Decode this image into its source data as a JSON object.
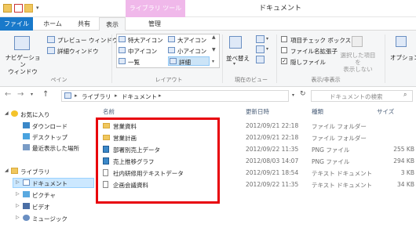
{
  "titlebar": {
    "context_tab": "ライブラリ ツール",
    "window_title": "ドキュメント"
  },
  "tabs": {
    "file": "ファイル",
    "home": "ホーム",
    "share": "共有",
    "view": "表示",
    "manage": "管理"
  },
  "ribbon": {
    "navpane_label": "ナビゲーション\nウィンドウ",
    "preview_pane": "プレビュー ウィンドウ",
    "details_pane": "詳細ウィンドウ",
    "pane_group": "ペイン",
    "layout": {
      "extra_large": "特大アイコン",
      "large": "大アイコン",
      "medium": "中アイコン",
      "small": "小アイコン",
      "list": "一覧",
      "details": "詳細",
      "group": "レイアウト"
    },
    "sort": "並べ替え",
    "current_view_group": "現在のビュー",
    "item_checkbox": "項目チェック ボックス",
    "file_ext": "ファイル名拡張子",
    "hidden_files": "隠しファイル",
    "hidden_checked": "✓",
    "show_hide_group": "表示/非表示",
    "hide_selected": "選択した項目を\n表示しない",
    "options": "オプション"
  },
  "address": {
    "path_1": "ライブラリ",
    "path_2": "ドキュメント",
    "search_placeholder": "ドキュメントの検索"
  },
  "nav": {
    "favorites": "お気に入り",
    "downloads": "ダウンロード",
    "desktop": "デスクトップ",
    "recent": "最近表示した場所",
    "libraries": "ライブラリ",
    "documents": "ドキュメント",
    "pictures": "ピクチャ",
    "videos": "ビデオ",
    "music": "ミュージック"
  },
  "columns": {
    "name": "名前",
    "modified": "更新日時",
    "type": "種類",
    "size": "サイズ"
  },
  "files": [
    {
      "name": "営業資料",
      "modified": "2012/09/21 22:18",
      "type": "ファイル フォルダー",
      "size": "",
      "icon": "folder"
    },
    {
      "name": "営業計画",
      "modified": "2012/09/21 22:18",
      "type": "ファイル フォルダー",
      "size": "",
      "icon": "folder"
    },
    {
      "name": "部署別売上データ",
      "modified": "2012/09/22 11:35",
      "type": "PNG ファイル",
      "size": "255 KB",
      "icon": "png"
    },
    {
      "name": "売上推移グラフ",
      "modified": "2012/08/03 14:07",
      "type": "PNG ファイル",
      "size": "294 KB",
      "icon": "png"
    },
    {
      "name": "社内研修用テキストデータ",
      "modified": "2012/09/21 18:54",
      "type": "テキスト ドキュメント",
      "size": "3 KB",
      "icon": "txt"
    },
    {
      "name": "企画会議資料",
      "modified": "2012/09/22 11:35",
      "type": "テキスト ドキュメント",
      "size": "34 KB",
      "icon": "txt"
    }
  ]
}
